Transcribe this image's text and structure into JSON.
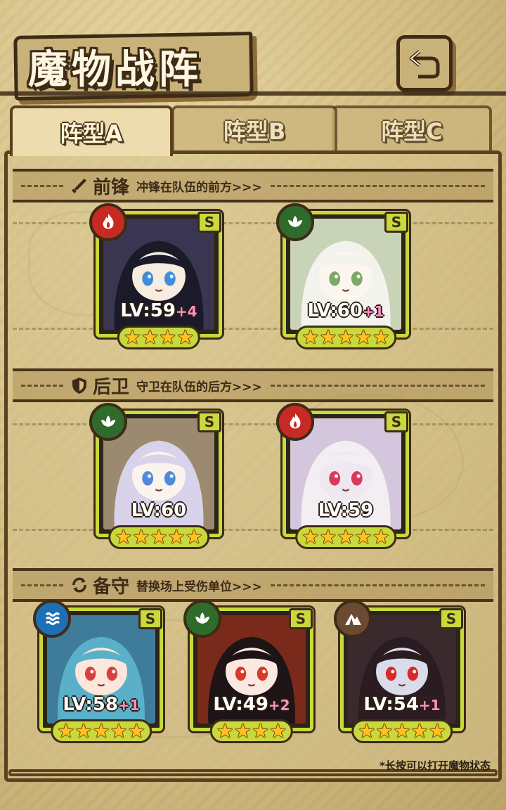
{
  "title": "魔物战阵",
  "tabs": [
    {
      "prefix": "阵型",
      "letter": "A",
      "active": true
    },
    {
      "prefix": "阵型",
      "letter": "B",
      "active": false
    },
    {
      "prefix": "阵型",
      "letter": "C",
      "active": false
    }
  ],
  "sections": {
    "front": {
      "name": "前锋",
      "desc": "冲锋在队伍的前方>>>",
      "icon": "sword-icon"
    },
    "rear": {
      "name": "后卫",
      "desc": "守卫在队伍的后方>>>",
      "icon": "shield-icon"
    },
    "reserve": {
      "name": "备守",
      "desc": "替换场上受伤单位>>>",
      "icon": "swap-icon"
    }
  },
  "cards": [
    {
      "section": "front",
      "element": "fire",
      "rank": "S",
      "level": "LV:59",
      "bonus": "+4",
      "stars": 4
    },
    {
      "section": "front",
      "element": "leaf",
      "rank": "S",
      "level": "LV:60",
      "bonus": "+1",
      "stars": 5
    },
    {
      "section": "rear",
      "element": "leaf",
      "rank": "S",
      "level": "LV:60",
      "bonus": "",
      "stars": 5
    },
    {
      "section": "rear",
      "element": "fire",
      "rank": "S",
      "level": "LV:59",
      "bonus": "",
      "stars": 5
    },
    {
      "section": "reserve",
      "element": "water",
      "rank": "S",
      "level": "LV:58",
      "bonus": "+1",
      "stars": 5
    },
    {
      "section": "reserve",
      "element": "leaf",
      "rank": "S",
      "level": "LV:49",
      "bonus": "+2",
      "stars": 4
    },
    {
      "section": "reserve",
      "element": "earth",
      "rank": "S",
      "level": "LV:54",
      "bonus": "+1",
      "stars": 5
    }
  ],
  "footnote": "*长按可以打开魔物状态",
  "colors": {
    "fire": "#c62a22",
    "leaf": "#2f6b2a",
    "water": "#1f6fb5",
    "earth": "#6b4a32",
    "frame": "#c8d93c",
    "star": "#ffc21e"
  }
}
